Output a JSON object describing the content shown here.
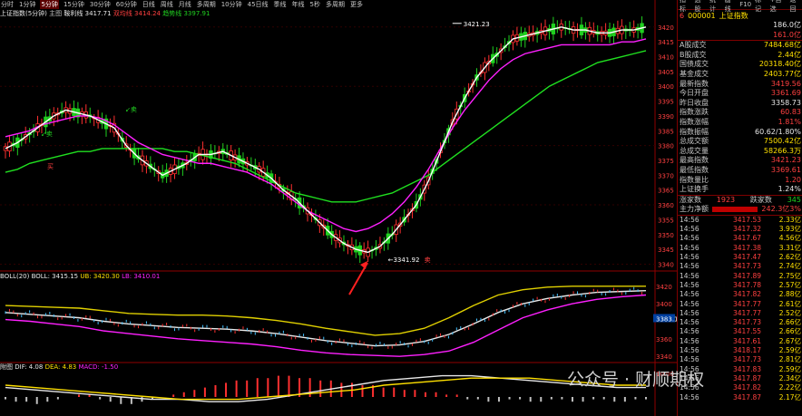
{
  "toolbar": {
    "items": [
      "分时",
      "1分钟",
      "5分钟",
      "15分钟",
      "30分钟",
      "60分钟",
      "日线",
      "周线",
      "月线",
      "多周期",
      "10分钟",
      "45日线",
      "季线",
      "年线",
      "5秒",
      "多周期",
      "更多"
    ],
    "active_index": 2,
    "right_items": [
      "指标",
      "选股",
      "统计",
      "画线",
      "F10",
      "标记",
      "+自选",
      "返回"
    ]
  },
  "main_title": {
    "name": "上证指数(5分钟)",
    "subject": "主图",
    "indicator": "鞍利线",
    "last": "3417.71",
    "l1": "双均线",
    "l1v": "3414.24",
    "l2": "趋势线",
    "l2v": "3397.91"
  },
  "annotations": {
    "high": "3421.23",
    "low": "3341.92",
    "buy1": "买",
    "sell1": "卖",
    "sell2": "卖",
    "sell3": "卖"
  },
  "boll_title": {
    "name": "BOLL(20)",
    "boll": "BOLL: 3415.15",
    "ub": "UB: 3420.30",
    "lb": "LB: 3410.01"
  },
  "macd_title": {
    "name": "附图",
    "dif": "DIF: 4.08",
    "dea": "DEA: 4.83",
    "macd": "MACD: -1.50"
  },
  "axis_main": [
    "3420",
    "3415",
    "3410",
    "3405",
    "3400",
    "3395",
    "3390",
    "3385",
    "3380",
    "3375",
    "3370",
    "3365",
    "3360",
    "3355",
    "3350",
    "3345",
    "3340"
  ],
  "axis_boll": [
    "3420",
    "3400",
    "3383.1",
    "3360",
    "3340"
  ],
  "axis_macd": [
    "10.00"
  ],
  "panel": {
    "code": "000001",
    "name": "上证指数",
    "badge": "6",
    "top_values": [
      "186.0亿",
      "161.0亿"
    ],
    "stats": [
      {
        "k": "A股成交",
        "v": "7484.68亿",
        "c": "yellow"
      },
      {
        "k": "B股成交",
        "v": "2.44亿",
        "c": "yellow"
      },
      {
        "k": "国债成交",
        "v": "20318.40亿",
        "c": "yellow"
      },
      {
        "k": "基金成交",
        "v": "2403.77亿",
        "c": "yellow"
      },
      {
        "k": "最新指数",
        "v": "3419.56",
        "c": "red"
      },
      {
        "k": "今日开盘",
        "v": "3361.69",
        "c": "red"
      },
      {
        "k": "昨日收盘",
        "v": "3358.73",
        "c": "white"
      },
      {
        "k": "指数涨跌",
        "v": "60.83",
        "c": "red"
      },
      {
        "k": "指数涨幅",
        "v": "1.81%",
        "c": "red"
      },
      {
        "k": "指数振幅",
        "v": "60.62/1.80%",
        "c": "white"
      },
      {
        "k": "总成交额",
        "v": "7500.42亿",
        "c": "yellow"
      },
      {
        "k": "总成交量",
        "v": "58266.3万",
        "c": "yellow"
      },
      {
        "k": "最高指数",
        "v": "3421.23",
        "c": "red"
      },
      {
        "k": "最低指数",
        "v": "3369.61",
        "c": "red"
      },
      {
        "k": "指数量比",
        "v": "1.20",
        "c": "red"
      },
      {
        "k": "上证换手",
        "v": "1.24%",
        "c": "white"
      }
    ],
    "updown": {
      "up_label": "涨家数",
      "up": "1923",
      "down_label": "跌家数",
      "down": "345"
    },
    "flow": {
      "label": "主力净额",
      "value": "242.3亿",
      "pct": "3%"
    },
    "ticks": [
      {
        "t": "14:56",
        "p": "3417.53",
        "v": "2.33亿"
      },
      {
        "t": "14:56",
        "p": "3417.32",
        "v": "3.93亿"
      },
      {
        "t": "14:56",
        "p": "3417.67",
        "v": "4.56亿"
      },
      {
        "t": "14:56",
        "p": "3417.38",
        "v": "3.31亿"
      },
      {
        "t": "14:56",
        "p": "3417.47",
        "v": "2.62亿"
      },
      {
        "t": "14:56",
        "p": "3417.73",
        "v": "2.74亿"
      },
      {
        "t": "14:56",
        "p": "3417.89",
        "v": "2.75亿"
      },
      {
        "t": "14:56",
        "p": "3417.78",
        "v": "2.57亿"
      },
      {
        "t": "14:56",
        "p": "3417.82",
        "v": "2.88亿"
      },
      {
        "t": "14:56",
        "p": "3417.77",
        "v": "2.61亿"
      },
      {
        "t": "14:56",
        "p": "3417.77",
        "v": "2.52亿"
      },
      {
        "t": "14:56",
        "p": "3417.73",
        "v": "2.66亿"
      },
      {
        "t": "14:56",
        "p": "3417.55",
        "v": "2.66亿"
      },
      {
        "t": "14:56",
        "p": "3417.61",
        "v": "2.67亿"
      },
      {
        "t": "14:56",
        "p": "3418.17",
        "v": "2.59亿"
      },
      {
        "t": "14:56",
        "p": "3417.73",
        "v": "2.81亿"
      },
      {
        "t": "14:56",
        "p": "3417.83",
        "v": "2.59亿"
      },
      {
        "t": "14:56",
        "p": "3417.87",
        "v": "2.34亿"
      },
      {
        "t": "14:56",
        "p": "3417.82",
        "v": "2.22亿"
      },
      {
        "t": "14:56",
        "p": "3417.87",
        "v": "2.17亿"
      }
    ]
  },
  "watermark": "公众号 · 财顺期权",
  "colors": {
    "up": "#ff3030",
    "down": "#20d020",
    "ma_fast": "#ffffff",
    "ma_mid": "#ff20ff",
    "ma_slow": "#20e020",
    "boll_mid": "#e8e8e8",
    "boll_ub": "#e0d000",
    "boll_lb": "#ff20ff"
  },
  "chart_data": [
    {
      "type": "candlestick",
      "title": "上证指数(5分钟)",
      "ylim": [
        3338,
        3423
      ],
      "fast_line": [
        3379,
        3381,
        3384,
        3387,
        3390,
        3392,
        3391,
        3390,
        3388,
        3386,
        3380,
        3376,
        3373,
        3370,
        3372,
        3374,
        3377,
        3377,
        3378,
        3376,
        3374,
        3372,
        3369,
        3365,
        3362,
        3358,
        3354,
        3350,
        3347,
        3345,
        3344,
        3346,
        3350,
        3355,
        3360,
        3368,
        3378,
        3388,
        3396,
        3403,
        3408,
        3412,
        3416,
        3417,
        3418,
        3419,
        3420,
        3419,
        3419,
        3418,
        3418,
        3419,
        3419,
        3420
      ],
      "mid_line": [
        3383,
        3384,
        3385,
        3387,
        3388,
        3389,
        3390,
        3390,
        3389,
        3387,
        3384,
        3381,
        3379,
        3377,
        3376,
        3375,
        3374,
        3374,
        3373,
        3372,
        3371,
        3369,
        3367,
        3364,
        3361,
        3358,
        3356,
        3354,
        3352,
        3351,
        3352,
        3354,
        3357,
        3361,
        3366,
        3372,
        3379,
        3386,
        3392,
        3397,
        3402,
        3406,
        3409,
        3411,
        3412,
        3413,
        3414,
        3414,
        3414,
        3414,
        3414,
        3415,
        3415,
        3416
      ],
      "slow_line": [
        3371,
        3372,
        3374,
        3375,
        3376,
        3377,
        3378,
        3378,
        3379,
        3379,
        3379,
        3379,
        3379,
        3379,
        3378,
        3378,
        3377,
        3376,
        3375,
        3374,
        3372,
        3370,
        3368,
        3366,
        3364,
        3363,
        3362,
        3361,
        3361,
        3361,
        3362,
        3363,
        3364,
        3366,
        3368,
        3370,
        3373,
        3376,
        3379,
        3382,
        3385,
        3388,
        3391,
        3394,
        3397,
        3400,
        3402,
        3404,
        3406,
        3408,
        3409,
        3410,
        3411,
        3412
      ],
      "highest": 3421.23,
      "lowest": 3341.92
    },
    {
      "type": "line",
      "title": "BOLL(20)",
      "ylim": [
        3335,
        3425
      ],
      "series": [
        {
          "name": "BOLL",
          "values": [
            3390,
            3388,
            3386,
            3384,
            3380,
            3377,
            3375,
            3373,
            3372,
            3371,
            3369,
            3366,
            3362,
            3358,
            3355,
            3352,
            3353,
            3357,
            3365,
            3377,
            3390,
            3400,
            3406,
            3410,
            3413,
            3414,
            3415
          ]
        },
        {
          "name": "UB",
          "values": [
            3398,
            3397,
            3396,
            3395,
            3392,
            3389,
            3388,
            3387,
            3387,
            3386,
            3384,
            3381,
            3377,
            3372,
            3368,
            3364,
            3366,
            3372,
            3384,
            3398,
            3410,
            3416,
            3419,
            3420,
            3420,
            3420,
            3420
          ]
        },
        {
          "name": "LB",
          "values": [
            3382,
            3380,
            3377,
            3374,
            3369,
            3366,
            3363,
            3360,
            3358,
            3356,
            3354,
            3351,
            3347,
            3344,
            3342,
            3341,
            3340,
            3342,
            3346,
            3356,
            3370,
            3384,
            3393,
            3400,
            3405,
            3408,
            3410
          ]
        }
      ]
    },
    {
      "type": "bar",
      "title": "MACD",
      "values": [
        -1,
        -2,
        -2,
        -3,
        -2,
        -1,
        0,
        1,
        1,
        -1,
        -2,
        -3,
        -3,
        -2,
        -1,
        0,
        1,
        2,
        3,
        4,
        5,
        6,
        7,
        7,
        8,
        8,
        9,
        9,
        8,
        8,
        7,
        7,
        6,
        6,
        5,
        5,
        4,
        4,
        3,
        3,
        2,
        2,
        1,
        1,
        -1,
        -1,
        -2,
        -2,
        -1,
        -1,
        -2,
        -2,
        -1,
        -1,
        -2,
        -2,
        -1,
        -1,
        -2,
        -2,
        -1,
        -1
      ],
      "series": [
        {
          "name": "DIF",
          "values": [
            4,
            3,
            2,
            1,
            0,
            -1,
            -1,
            -2,
            -2,
            -1,
            1,
            3,
            5,
            7,
            8,
            9,
            9,
            8,
            7,
            6,
            5,
            4,
            4
          ]
        },
        {
          "name": "DEA",
          "values": [
            5,
            4,
            3,
            2,
            1,
            0,
            -1,
            -1,
            -1,
            0,
            1,
            2,
            3,
            5,
            6,
            7,
            8,
            8,
            8,
            7,
            6,
            5,
            5
          ]
        }
      ]
    }
  ]
}
